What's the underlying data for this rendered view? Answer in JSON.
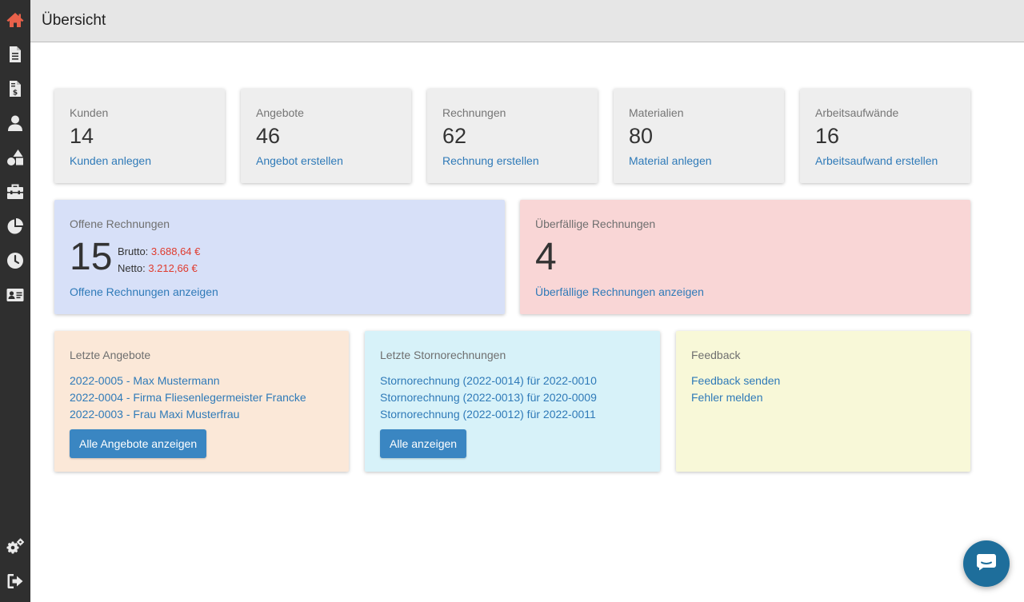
{
  "header": {
    "title": "Übersicht"
  },
  "sidebar": {
    "items": [
      {
        "icon": "home-icon",
        "active": true
      },
      {
        "icon": "document-icon"
      },
      {
        "icon": "invoice-icon"
      },
      {
        "icon": "user-icon"
      },
      {
        "icon": "shapes-icon"
      },
      {
        "icon": "toolbox-icon"
      },
      {
        "icon": "pie-chart-icon"
      },
      {
        "icon": "clock-icon"
      },
      {
        "icon": "contact-card-icon"
      },
      {
        "icon": "settings-icon"
      },
      {
        "icon": "logout-icon"
      }
    ],
    "accent": "#e8614a"
  },
  "stats": [
    {
      "label": "Kunden",
      "count": "14",
      "link": "Kunden anlegen"
    },
    {
      "label": "Angebote",
      "count": "46",
      "link": "Angebot erstellen"
    },
    {
      "label": "Rechnungen",
      "count": "62",
      "link": "Rechnung erstellen"
    },
    {
      "label": "Materialien",
      "count": "80",
      "link": "Material anlegen"
    },
    {
      "label": "Arbeitsaufwände",
      "count": "16",
      "link": "Arbeitsaufwand erstellen"
    }
  ],
  "open_invoices": {
    "label": "Offene Rechnungen",
    "count": "15",
    "brutto_label": "Brutto:",
    "brutto_value": "3.688,64 €",
    "netto_label": "Netto:",
    "netto_value": "3.212,66 €",
    "link": "Offene Rechnungen anzeigen",
    "color": "#d7e0f8"
  },
  "overdue_invoices": {
    "label": "Überfällige Rechnungen",
    "count": "4",
    "link": "Überfällige Rechnungen anzeigen",
    "color": "#f9d6d6"
  },
  "recent_offers": {
    "label": "Letzte Angebote",
    "items": [
      "2022-0005 - Max Mustermann",
      "2022-0004 - Firma Fliesenlegermeister Francke",
      "2022-0003 - Frau Maxi Musterfrau"
    ],
    "button": "Alle Angebote anzeigen",
    "color": "#fbe8d8"
  },
  "recent_cancellations": {
    "label": "Letzte Stornorechnungen",
    "items": [
      "Stornorechnung (2022-0014) für 2022-0010",
      "Stornorechnung (2022-0013) für 2020-0009",
      "Stornorechnung (2022-0012) für 2022-0011"
    ],
    "button": "Alle anzeigen",
    "color": "#d7f2f9"
  },
  "feedback": {
    "label": "Feedback",
    "items": [
      "Feedback senden",
      "Fehler melden"
    ],
    "color": "#f8f8d8"
  },
  "chat": {
    "icon": "chat-icon"
  }
}
